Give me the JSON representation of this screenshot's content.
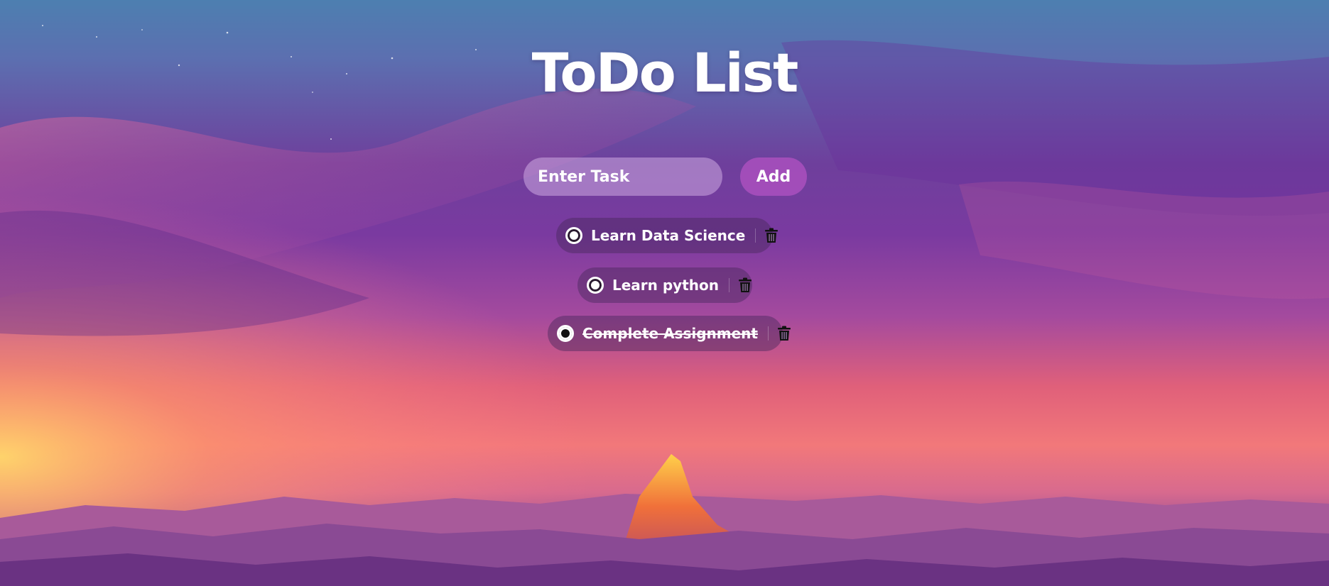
{
  "app": {
    "title": "ToDo List"
  },
  "form": {
    "input_placeholder": "Enter Task",
    "input_value": "",
    "add_label": "Add"
  },
  "tasks": [
    {
      "label": "Learn Data Science",
      "completed": false
    },
    {
      "label": "Learn python",
      "completed": false
    },
    {
      "label": "Complete Assignment",
      "completed": true
    }
  ],
  "icons": {
    "complete_toggle": "radio-circle-icon",
    "delete": "trash-icon"
  },
  "colors": {
    "title_text": "#ffffff",
    "add_button": "#aa50be",
    "task_pill": "#46285a",
    "trash_icon": "#111111"
  }
}
